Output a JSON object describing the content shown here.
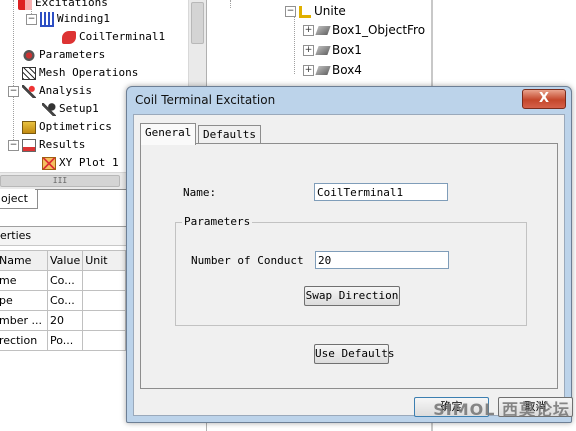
{
  "left_tree": {
    "items": [
      {
        "label": "Excitations"
      },
      {
        "label": "Winding1"
      },
      {
        "label": "CoilTerminal1"
      },
      {
        "label": "Parameters"
      },
      {
        "label": "Mesh Operations"
      },
      {
        "label": "Analysis"
      },
      {
        "label": "Setup1"
      },
      {
        "label": "Optimetrics"
      },
      {
        "label": "Results"
      },
      {
        "label": "XY Plot 1"
      }
    ],
    "hscroll_grip": "III"
  },
  "left_tabs": {
    "object_tab": "oject",
    "properties_header": "erties"
  },
  "props": {
    "headers": [
      "Name",
      "Value",
      "Unit"
    ],
    "rows": [
      {
        "name": "me",
        "value": "Co..."
      },
      {
        "name": "pe",
        "value": "Co..."
      },
      {
        "name": "mber ...",
        "value": "20"
      },
      {
        "name": "rection",
        "value": "Po..."
      }
    ]
  },
  "right_tree": {
    "items": [
      {
        "label": "Unite"
      },
      {
        "label": "Box1_ObjectFro"
      },
      {
        "label": "Box1"
      },
      {
        "label": "Box4"
      }
    ]
  },
  "dialog": {
    "title": "Coil Terminal Excitation",
    "close_glyph": "X",
    "tabs": [
      "General",
      "Defaults"
    ],
    "name_label": "Name:",
    "name_value": "CoilTerminal1",
    "group_title": "Parameters",
    "conductors_label": "Number of Conductor",
    "conductors_value": "20",
    "swap_button": "Swap Direction",
    "defaults_button": "Use Defaults",
    "ok_button": "确定",
    "cancel_button": "取消"
  },
  "watermark": "SIMOL 西莫论坛",
  "colors": {
    "title_bar": "#bcd3ea",
    "close_red": "#c4472b",
    "panel_bg": "#f0f0f0"
  }
}
